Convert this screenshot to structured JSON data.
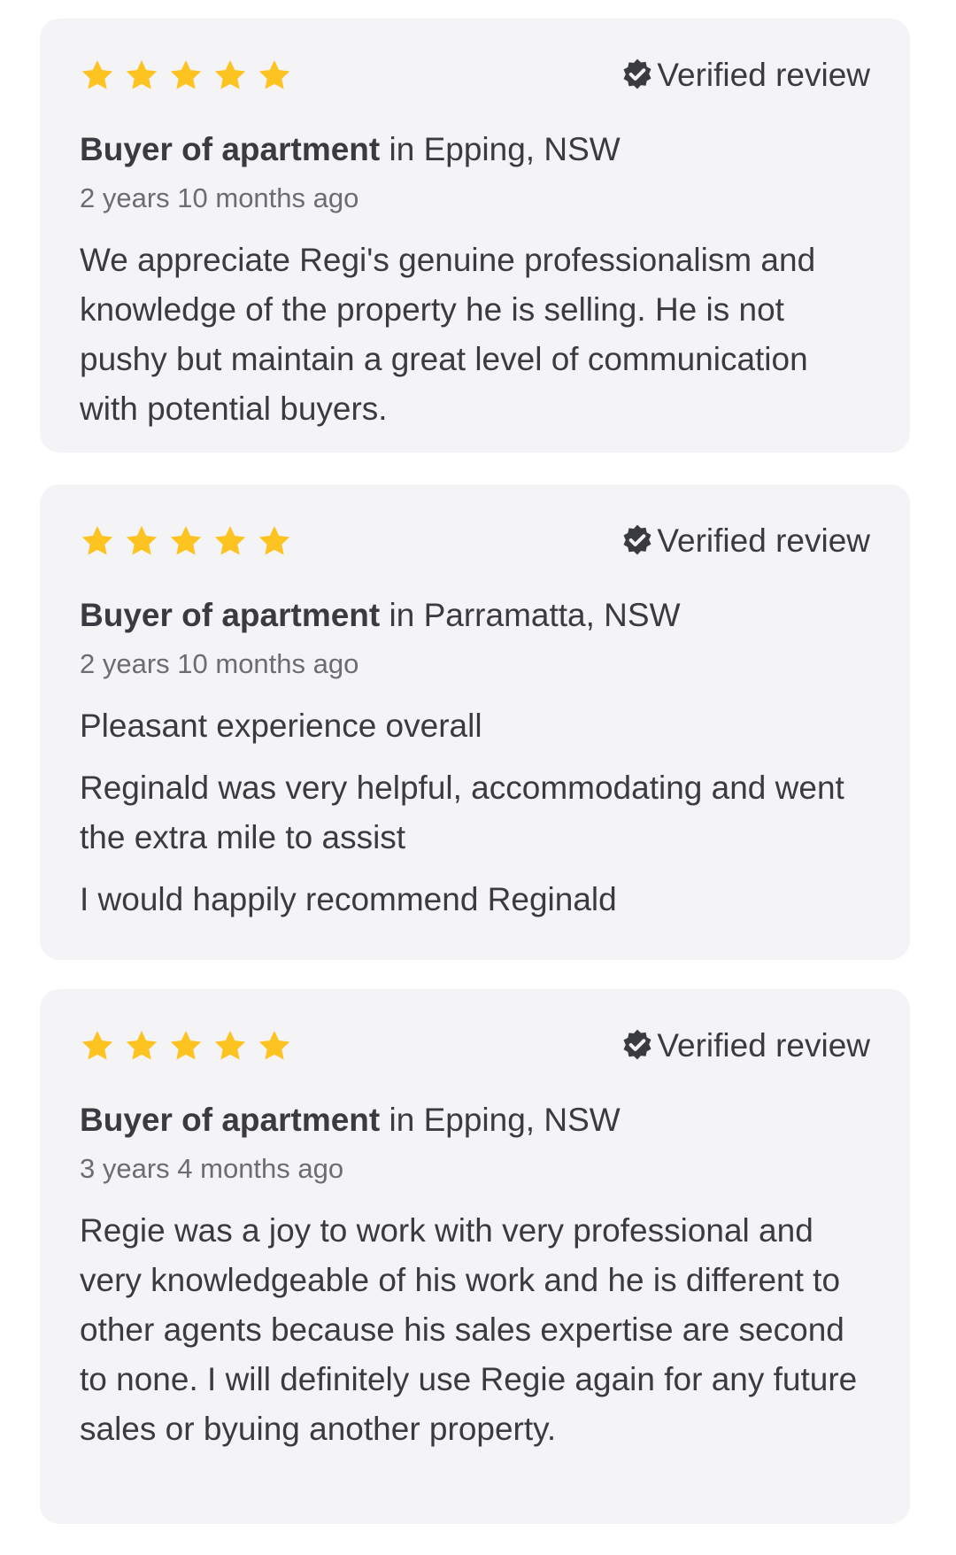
{
  "colors": {
    "star": "#fdc321",
    "card_background": "#f4f4f6",
    "text": "#3a3b40",
    "muted_text": "#6c6d73",
    "verified_icon": "#3a3b40"
  },
  "icons": {
    "rating": "star-icon",
    "verified": "verified-badge-icon"
  },
  "reviews": [
    {
      "rating": 5,
      "verified_label": "Verified review",
      "reviewer_role": "Buyer of apartment",
      "reviewer_location": " in Epping, NSW",
      "time_ago": "2 years 10 months ago",
      "paragraphs": [
        "We appreciate Regi's genuine professionalism and knowledge of the property he is selling. He is not pushy but maintain a great level of communication with potential buyers."
      ]
    },
    {
      "rating": 5,
      "verified_label": "Verified review",
      "reviewer_role": "Buyer of apartment",
      "reviewer_location": " in Parramatta, NSW",
      "time_ago": "2 years 10 months ago",
      "paragraphs": [
        "Pleasant experience overall",
        "Reginald was very helpful, accommodating and went the extra mile to assist",
        "I would happily recommend Reginald"
      ]
    },
    {
      "rating": 5,
      "verified_label": "Verified review",
      "reviewer_role": "Buyer of apartment",
      "reviewer_location": " in Epping, NSW",
      "time_ago": "3 years 4 months ago",
      "paragraphs": [
        "Regie was a joy to work with very professional and very knowledgeable of his work and he is different to other agents because his sales expertise are second to none. I will definitely use Regie again for any future sales or byuing another property."
      ]
    }
  ]
}
